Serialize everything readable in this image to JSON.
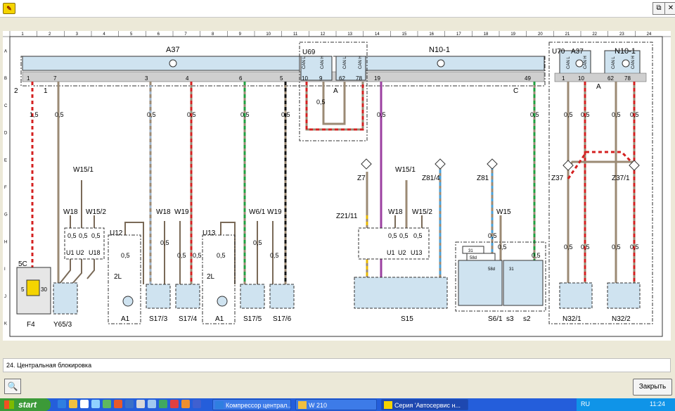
{
  "window": {
    "minimize_symbol": "⧉",
    "close_symbol": "✕"
  },
  "ruler": [
    "1",
    "2",
    "3",
    "4",
    "5",
    "6",
    "7",
    "8",
    "9",
    "10",
    "11",
    "12",
    "13",
    "14",
    "15",
    "16",
    "17",
    "18",
    "19",
    "20",
    "21",
    "22",
    "23",
    "24"
  ],
  "rows": [
    "A",
    "B",
    "C",
    "D",
    "E",
    "F",
    "G",
    "H",
    "I",
    "J",
    "K"
  ],
  "blocks": {
    "a37": "A37",
    "u69": "U69",
    "n10_1": "N10-1",
    "u70": "U70",
    "a37r": "A37",
    "n10_1r": "N10-1"
  },
  "pins": {
    "p2": "2",
    "p1": "1",
    "p7": "7",
    "p3": "3",
    "p4": "4",
    "p6": "6",
    "p5": "5",
    "p10": "10",
    "p9": "9",
    "p62": "62",
    "p78": "78",
    "p19": "19",
    "p49": "49",
    "p1r": "1",
    "p10r": "10",
    "p62r": "62",
    "p78r": "78"
  },
  "letters": {
    "a1": "A",
    "c": "C",
    "a2": "A"
  },
  "can": {
    "l": "CAN L",
    "h": "CAN H"
  },
  "section": {
    "v15": "1,5",
    "v05": "0,5"
  },
  "wires": {
    "w15_1a": "W15/1",
    "w18a": "W18",
    "w15_2a": "W15/2",
    "w18b": "W18",
    "w19a": "W19",
    "w6_1": "W6/1",
    "w19b": "W19",
    "z7": "Z7",
    "w15_1b": "W15/1",
    "z81_4": "Z81/4",
    "z21_11": "Z21/11",
    "w18c": "W18",
    "w15_2b": "W15/2",
    "z81": "Z81",
    "w15": "W15",
    "z37": "Z37",
    "z37_1": "Z37/1"
  },
  "units": {
    "u1": "U1",
    "u2": "U2",
    "u18": "U18",
    "u12": "U12",
    "u13": "U13",
    "u1b": "U1",
    "u2b": "U2",
    "u13b": "U13"
  },
  "components": {
    "c5c": "5C",
    "c5": "5",
    "c30": "30",
    "f4": "F4",
    "y65_3": "Y65/3",
    "l2a": "2L",
    "a1a": "A1",
    "s17_3": "S17/3",
    "s17_4": "S17/4",
    "l2b": "2L",
    "a1b": "A1",
    "s17_5": "S17/5",
    "s17_6": "S17/6",
    "s15": "S15",
    "s6_1": "S6/1",
    "s3": "s3",
    "s2": "s2",
    "n32_1": "N32/1",
    "n32_2": "N32/2",
    "t31": "31",
    "t58d": "58d",
    "t58dr": "58d",
    "t31b": "31"
  },
  "caption": "24. Центральная блокировка",
  "buttons": {
    "zoom": "🔍",
    "close": "Закрыть"
  },
  "taskbar": {
    "start": "start",
    "items": [
      {
        "label": "Компрессор централ..."
      },
      {
        "label": "W 210"
      },
      {
        "label": "Серия 'Автосервис н..."
      }
    ],
    "lang": "RU",
    "clock": "11:24"
  }
}
